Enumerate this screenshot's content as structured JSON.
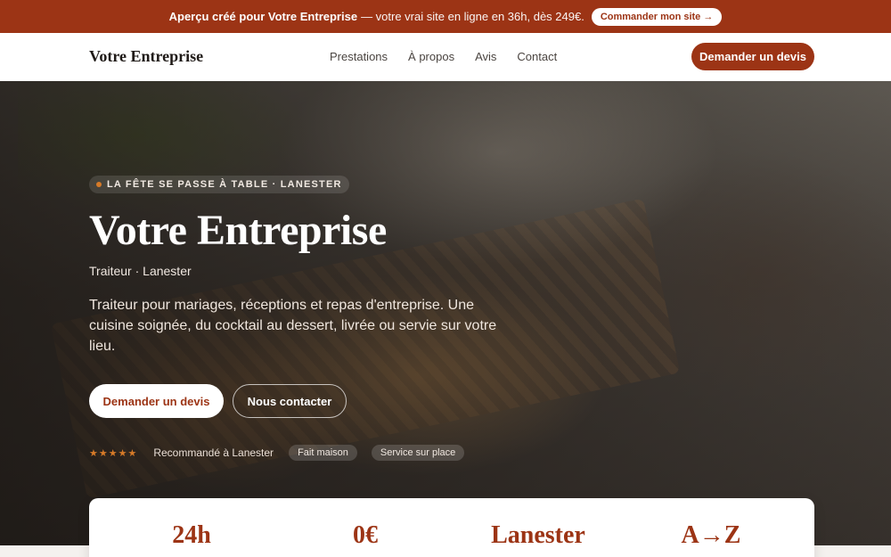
{
  "promo": {
    "bold": "Aperçu créé pour Votre Entreprise",
    "rest": "— votre vrai site en ligne en 36h, dès 249€.",
    "cta": "Commander mon site →"
  },
  "nav": {
    "brand": "Votre Entreprise",
    "links": [
      "Prestations",
      "À propos",
      "Avis",
      "Contact"
    ],
    "cta": "Demander un devis"
  },
  "hero": {
    "eyebrow": "LA FÊTE SE PASSE À TABLE · LANESTER",
    "title": "Votre Entreprise",
    "subtitle": "Traiteur · Lanester",
    "description": "Traiteur pour mariages, réceptions et repas d'entreprise. Une cuisine soignée, du cocktail au dessert, livrée ou servie sur votre lieu.",
    "primary_cta": "Demander un devis",
    "secondary_cta": "Nous contacter",
    "stars": "★★★★★",
    "recommended": "Recommandé à Lanester",
    "tags": [
      "Fait maison",
      "Service sur place"
    ]
  },
  "stats": [
    "24h",
    "0€",
    "Lanester",
    "A→Z"
  ],
  "colors": {
    "accent": "#9c3415",
    "star": "#d67a28"
  }
}
